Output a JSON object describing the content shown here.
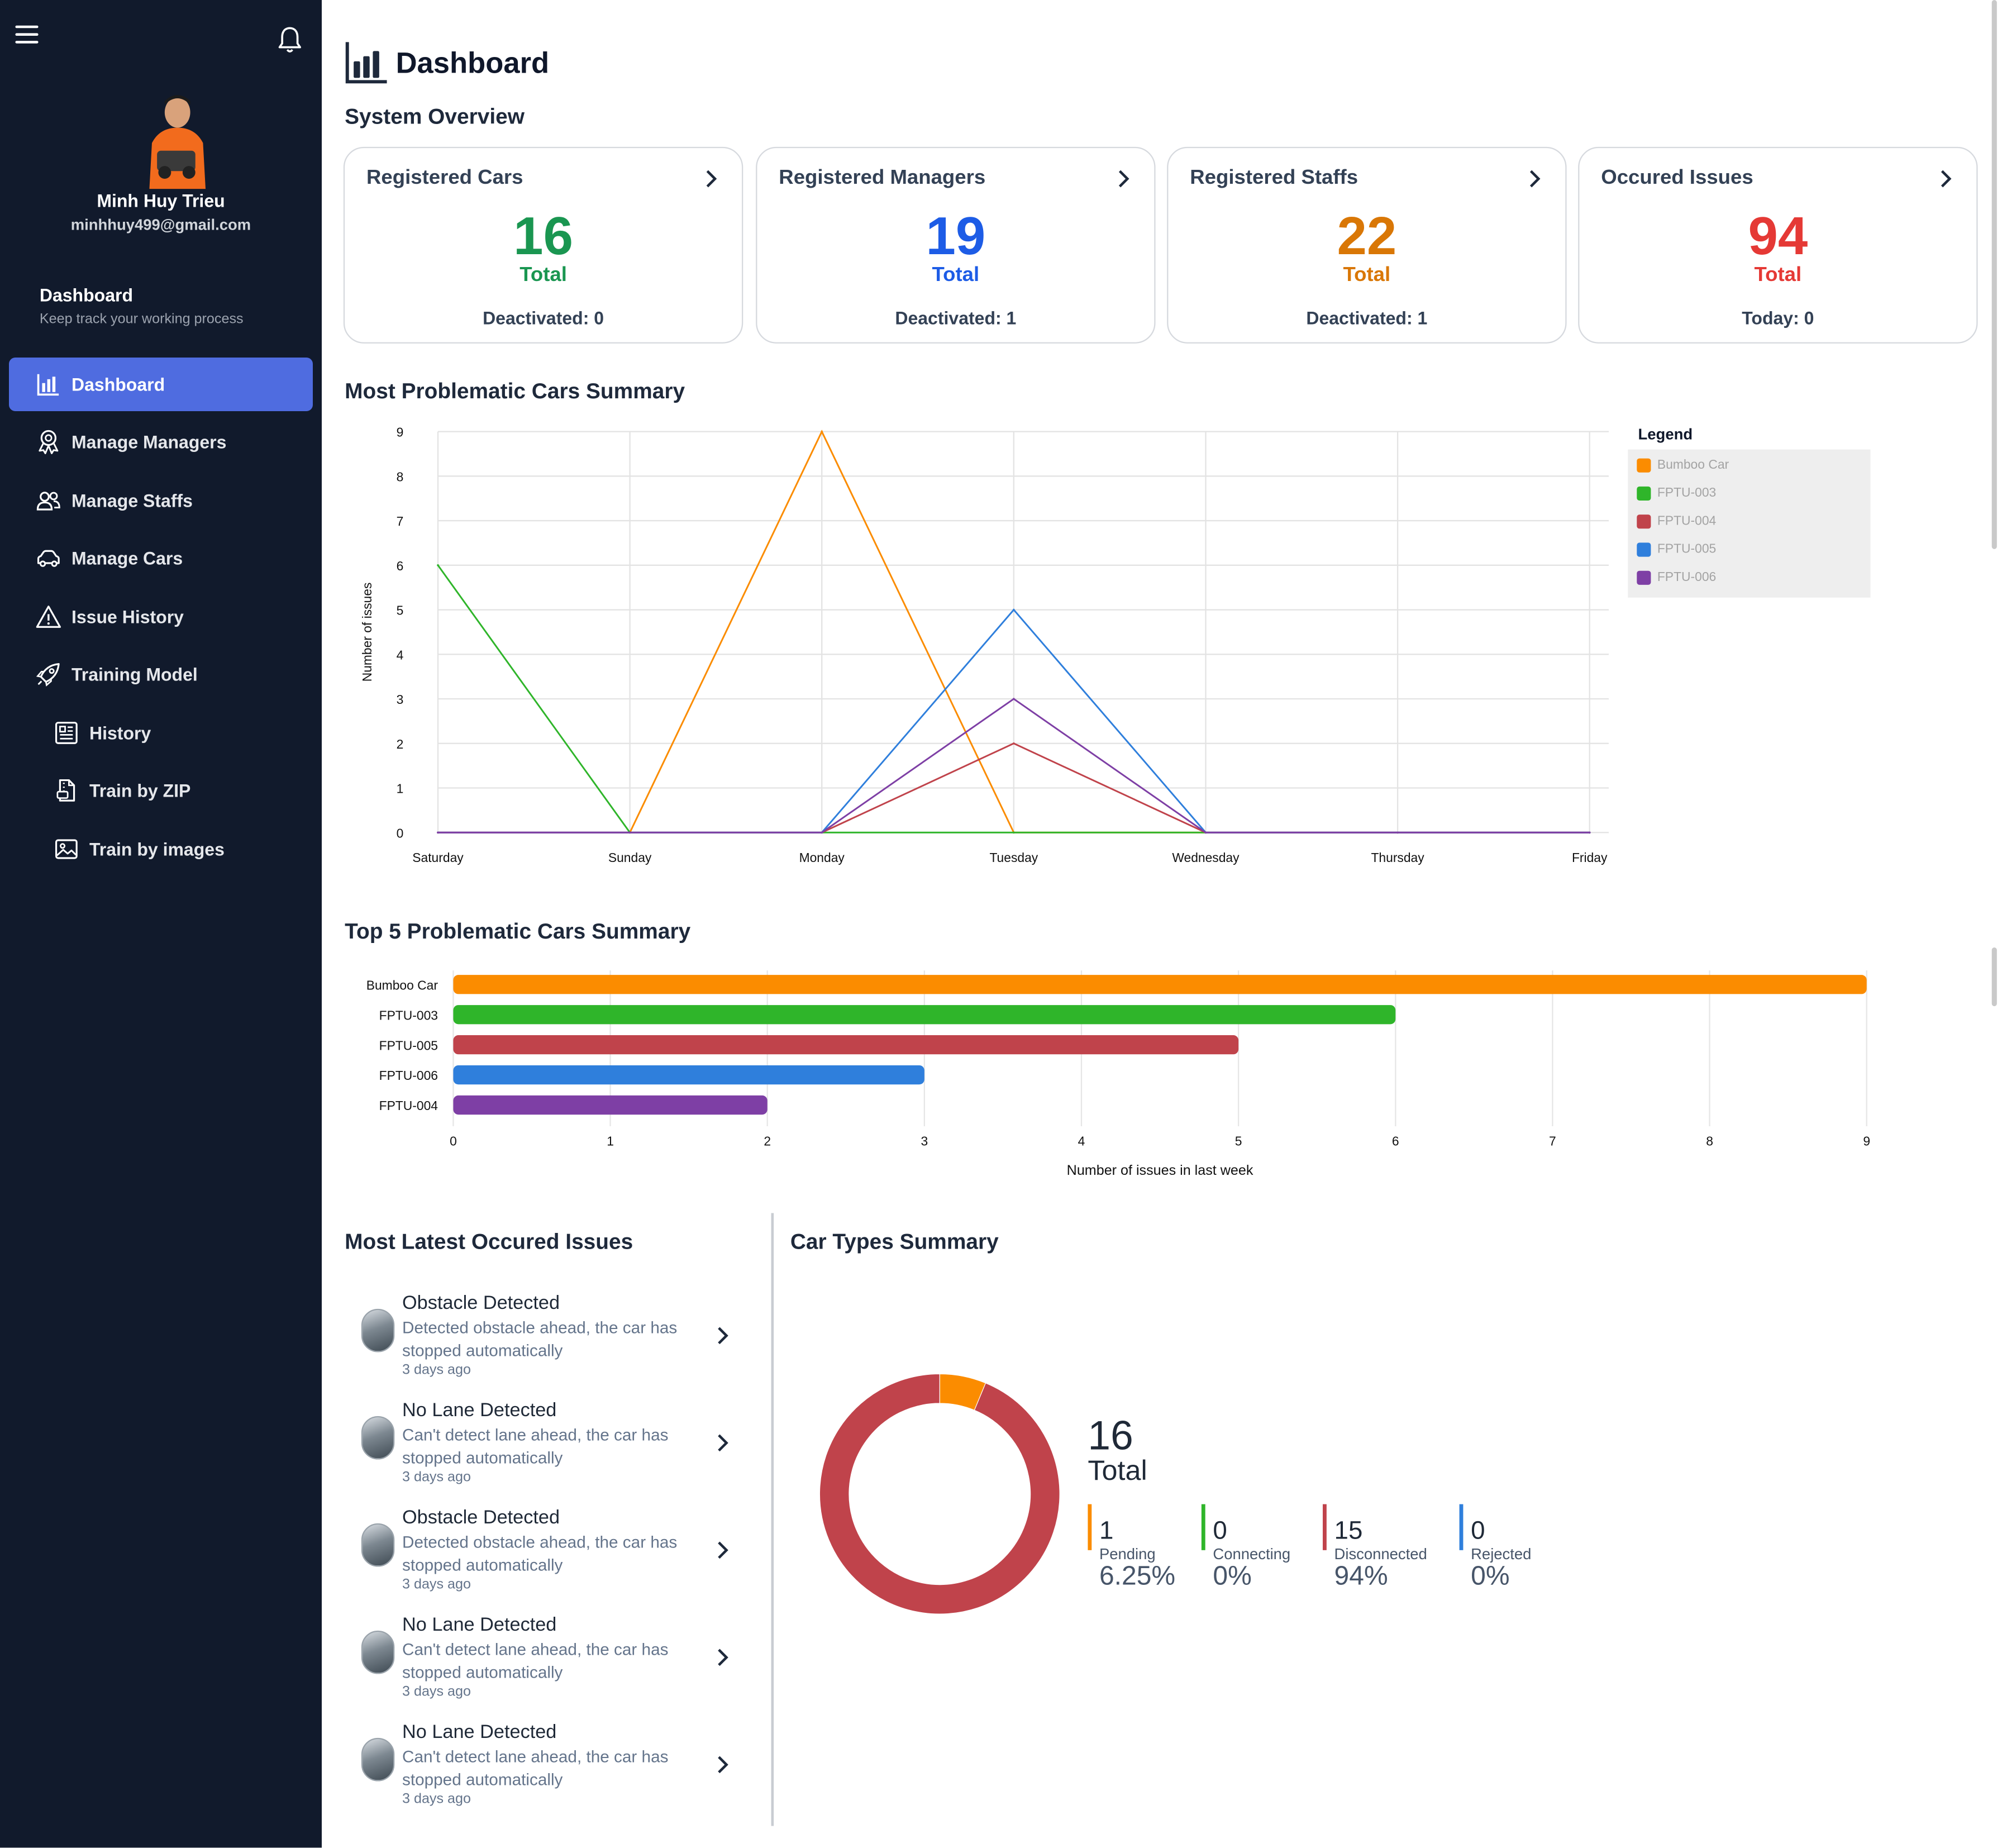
{
  "user": {
    "name": "Minh Huy Trieu",
    "email": "minhhuy499@gmail.com"
  },
  "sidebar": {
    "title": "Dashboard",
    "subtitle": "Keep track your working process",
    "items": [
      {
        "label": "Dashboard",
        "icon": "bar-chart-icon"
      },
      {
        "label": "Manage Managers",
        "icon": "award-icon"
      },
      {
        "label": "Manage Staffs",
        "icon": "users-icon"
      },
      {
        "label": "Manage Cars",
        "icon": "car-icon"
      },
      {
        "label": "Issue History",
        "icon": "warning-icon"
      },
      {
        "label": "Training Model",
        "icon": "rocket-icon"
      },
      {
        "label": "History",
        "icon": "news-icon"
      },
      {
        "label": "Train by ZIP",
        "icon": "file-zip-icon"
      },
      {
        "label": "Train by images",
        "icon": "image-icon"
      }
    ]
  },
  "page": {
    "title": "Dashboard"
  },
  "overview": {
    "title": "System Overview",
    "cards": [
      {
        "title": "Registered Cars",
        "value": "16",
        "total_label": "Total",
        "footer": "Deactivated: 0",
        "color": "#1a9651"
      },
      {
        "title": "Registered Managers",
        "value": "19",
        "total_label": "Total",
        "footer": "Deactivated: 1",
        "color": "#1d5ce6"
      },
      {
        "title": "Registered Staffs",
        "value": "22",
        "total_label": "Total",
        "footer": "Deactivated: 1",
        "color": "#d97706"
      },
      {
        "title": "Occured Issues",
        "value": "94",
        "total_label": "Total",
        "footer": "Today: 0",
        "color": "#e53935"
      }
    ]
  },
  "line_section": {
    "title": "Most Problematic Cars Summary",
    "legend_title": "Legend"
  },
  "bar_section": {
    "title": "Top 5 Problematic Cars Summary"
  },
  "issues_section": {
    "title": "Most Latest Occured Issues",
    "items": [
      {
        "title": "Obstacle Detected",
        "desc": "Detected obstacle ahead, the car has stopped automatically",
        "time": "3 days ago"
      },
      {
        "title": "No Lane Detected",
        "desc": "Can't detect lane ahead, the car has stopped automatically",
        "time": "3 days ago"
      },
      {
        "title": "Obstacle Detected",
        "desc": "Detected obstacle ahead, the car has stopped automatically",
        "time": "3 days ago"
      },
      {
        "title": "No Lane Detected",
        "desc": "Can't detect lane ahead, the car has stopped automatically",
        "time": "3 days ago"
      },
      {
        "title": "No Lane Detected",
        "desc": "Can't detect lane ahead, the car has stopped automatically",
        "time": "3 days ago"
      }
    ]
  },
  "car_types": {
    "title": "Car Types Summary",
    "total": "16",
    "total_label": "Total",
    "stats": [
      {
        "value": "1",
        "label": "Pending",
        "pct": "6.25%",
        "color": "#fb8c00"
      },
      {
        "value": "0",
        "label": "Connecting",
        "pct": "0%",
        "color": "#2fb52a"
      },
      {
        "value": "15",
        "label": "Disconnected",
        "pct": "94%",
        "color": "#c0434b"
      },
      {
        "value": "0",
        "label": "Rejected",
        "pct": "0%",
        "color": "#2f7fdc"
      }
    ]
  },
  "chart_data": [
    {
      "type": "line",
      "title": "Most Problematic Cars Summary",
      "xlabel": "",
      "ylabel": "Number of issues",
      "categories": [
        "Saturday",
        "Sunday",
        "Monday",
        "Tuesday",
        "Wednesday",
        "Thursday",
        "Friday"
      ],
      "ylim": [
        0,
        9
      ],
      "yticks": [
        0,
        1,
        2,
        3,
        4,
        5,
        6,
        7,
        8,
        9
      ],
      "grid": true,
      "legend_position": "right",
      "series": [
        {
          "name": "Bumboo Car",
          "color": "#fb8c00",
          "values": [
            0,
            0,
            9,
            0,
            0,
            0,
            0
          ]
        },
        {
          "name": "FPTU-003",
          "color": "#2fb52a",
          "values": [
            6,
            0,
            0,
            0,
            0,
            0,
            0
          ]
        },
        {
          "name": "FPTU-004",
          "color": "#c0434b",
          "values": [
            0,
            0,
            0,
            2,
            0,
            0,
            0
          ]
        },
        {
          "name": "FPTU-005",
          "color": "#2f7fdc",
          "values": [
            0,
            0,
            0,
            5,
            0,
            0,
            0
          ]
        },
        {
          "name": "FPTU-006",
          "color": "#7e3fa5",
          "values": [
            0,
            0,
            0,
            3,
            0,
            0,
            0
          ]
        }
      ]
    },
    {
      "type": "bar",
      "orientation": "horizontal",
      "title": "Top 5 Problematic Cars Summary",
      "xlabel": "Number of issues in last week",
      "ylabel": "",
      "categories": [
        "Bumboo Car",
        "FPTU-003",
        "FPTU-005",
        "FPTU-006",
        "FPTU-004"
      ],
      "values": [
        9,
        6,
        5,
        3,
        2
      ],
      "colors": [
        "#fb8c00",
        "#2fb52a",
        "#c0434b",
        "#2f7fdc",
        "#7e3fa5"
      ],
      "xlim": [
        0,
        9
      ],
      "xticks": [
        0,
        1,
        2,
        3,
        4,
        5,
        6,
        7,
        8,
        9
      ],
      "grid": true
    },
    {
      "type": "pie",
      "title": "Car Types Summary",
      "labels": [
        "Pending",
        "Connecting",
        "Disconnected",
        "Rejected"
      ],
      "values": [
        1,
        0,
        15,
        0
      ],
      "colors": [
        "#fb8c00",
        "#2fb52a",
        "#c0434b",
        "#2f7fdc"
      ]
    }
  ]
}
